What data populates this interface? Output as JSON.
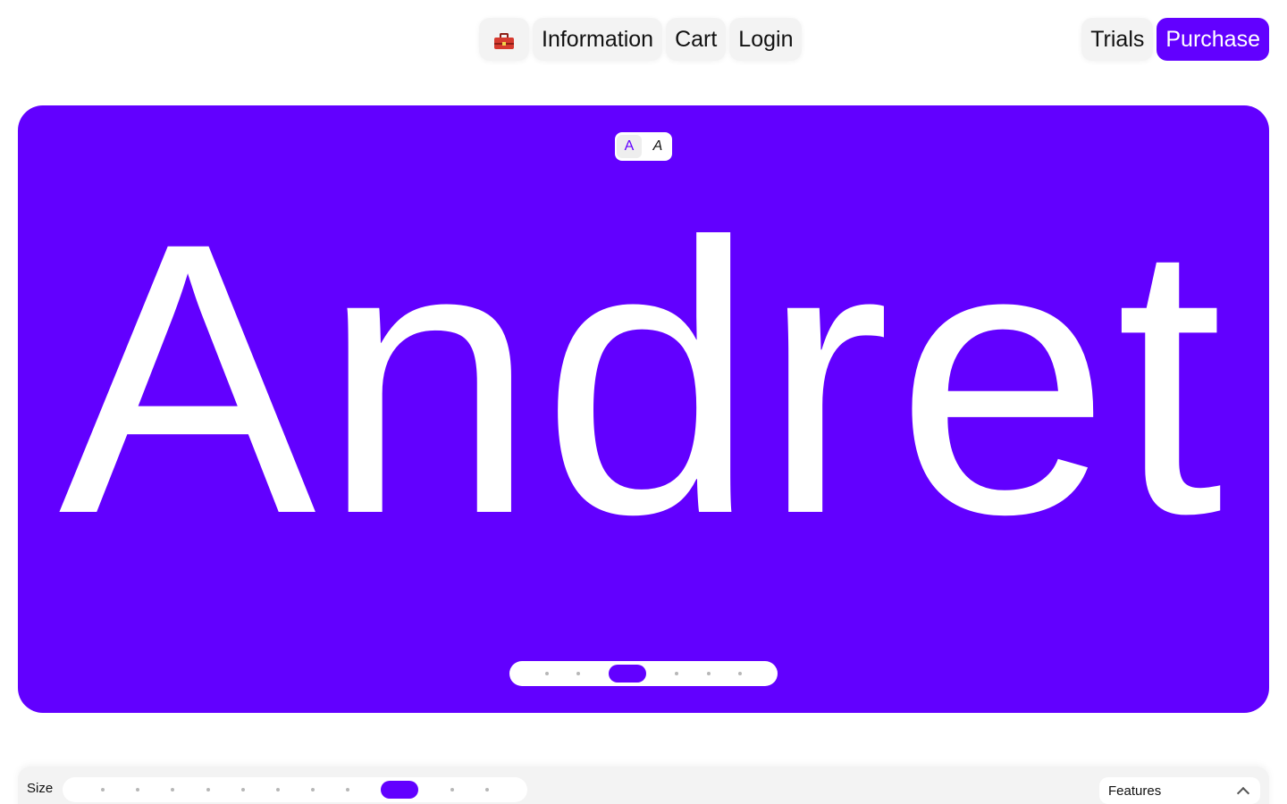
{
  "nav": {
    "logo_icon": "toolbox-icon",
    "information_label": "Information",
    "cart_label": "Cart",
    "login_label": "Login",
    "trials_label": "Trials",
    "purchase_label": "Purchase"
  },
  "hero": {
    "background_color": "#6200ff",
    "style_options": [
      "A",
      "A"
    ],
    "active_style": "regular",
    "specimen_text": "Andret",
    "slider_steps": 6,
    "slider_active_index": 2
  },
  "toolbar": {
    "size_label": "Size",
    "size_steps": 11,
    "size_active_index": 8,
    "features_label": "Features",
    "features_icon": "chevron-up-icon"
  },
  "colors": {
    "accent": "#6200ff",
    "pill_bg": "#f3f3f3"
  }
}
